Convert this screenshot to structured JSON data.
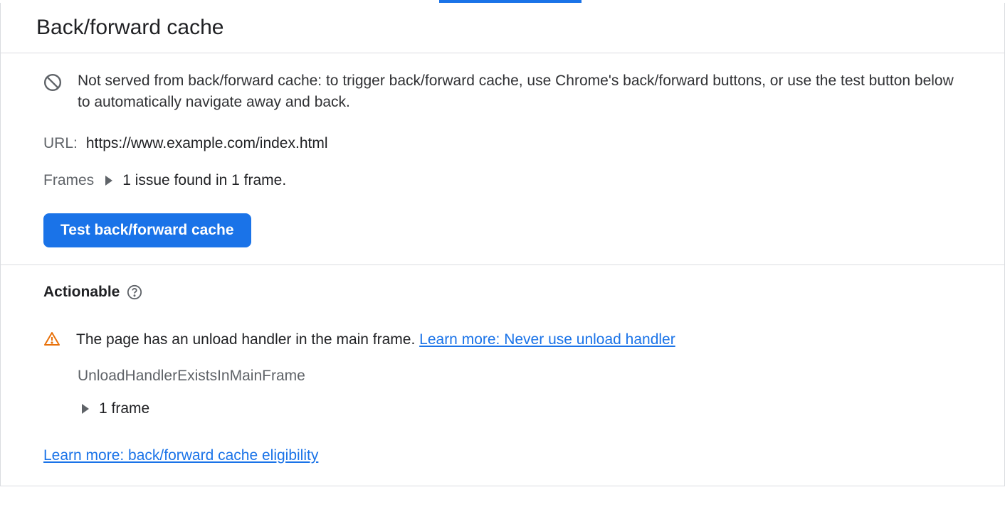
{
  "header": {
    "title": "Back/forward cache"
  },
  "info": {
    "message": "Not served from back/forward cache: to trigger back/forward cache, use Chrome's back/forward buttons, or use the test button below to automatically navigate away and back."
  },
  "url": {
    "label": "URL:",
    "value": "https://www.example.com/index.html"
  },
  "frames": {
    "label": "Frames",
    "summary": "1 issue found in 1 frame."
  },
  "buttons": {
    "test_label": "Test back/forward cache"
  },
  "actionable": {
    "title": "Actionable",
    "issue_text": "The page has an unload handler in the main frame. ",
    "issue_link": "Learn more: Never use unload handler",
    "issue_code": "UnloadHandlerExistsInMainFrame",
    "frame_count": "1 frame"
  },
  "footer": {
    "learn_more": "Learn more: back/forward cache eligibility"
  }
}
